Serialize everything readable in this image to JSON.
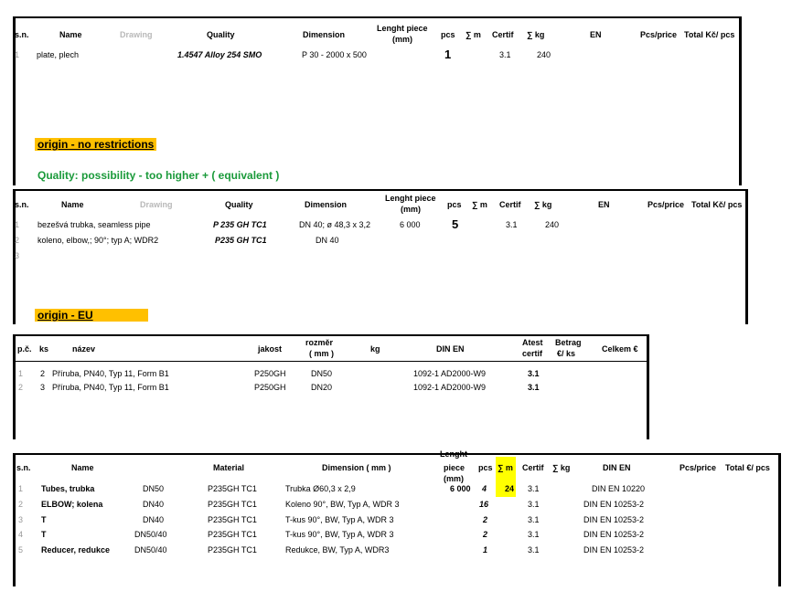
{
  "table1": {
    "headers": [
      "s.n.",
      "Name",
      "Drawing",
      "Quality",
      "Dimension",
      "Lenght piece",
      "(mm)",
      "pcs",
      "∑ m",
      "Certif",
      "∑ kg",
      "EN",
      "Pcs/price",
      "Total Kč/ pcs"
    ],
    "row": [
      "1",
      "plate, plech",
      "1.4547 Alloy 254 SMO",
      "P 30 - 2000 x 500",
      "1",
      "3.1",
      "240"
    ]
  },
  "note1": "origin - no restrictions",
  "note2": "Quality:  possibility -  too higher +   ( equivalent )",
  "table2": {
    "headers": [
      "s.n.",
      "Name",
      "Drawing",
      "Quality",
      "Dimension",
      "Lenght piece",
      "(mm)",
      "pcs",
      "∑ m",
      "Certif",
      "∑ kg",
      "EN",
      "Pcs/price",
      "Total Kč/ pcs"
    ],
    "rows": [
      [
        "1",
        "bezešvá trubka, seamless pipe",
        "P 235 GH TC1",
        "DN 40; ø 48,3 x 3,2",
        "6 000",
        "5",
        "3.1",
        "240"
      ],
      [
        "2",
        "koleno, elbow,; 90°; typ A; WDR2",
        "P235 GH TC1",
        "DN 40"
      ],
      [
        "3"
      ]
    ]
  },
  "note3": "origin - EU",
  "table3": {
    "headers": [
      "p.č.",
      "ks",
      "název",
      "jakost",
      "rozměr",
      "( mm )",
      "kg",
      "DIN EN",
      "Atest",
      "certif",
      "Betrag",
      "€/ ks",
      "Celkem €"
    ],
    "rows": [
      [
        "1",
        "2",
        "Příruba, PN40, Typ 11, Form B1",
        "P250GH",
        "DN50",
        "1092-1 AD2000-W9",
        "3.1"
      ],
      [
        "2",
        "3",
        "Příruba, PN40, Typ 11, Form B1",
        "P250GH",
        "DN20",
        "1092-1 AD2000-W9",
        "3.1"
      ]
    ]
  },
  "table4": {
    "headers": [
      "s.n.",
      "Name",
      "Material",
      "Dimension ( mm )",
      "Lenght",
      "piece",
      "(mm)",
      "pcs",
      "∑ m",
      "Certif",
      "∑ kg",
      "DIN EN",
      "Pcs/price",
      "Total €/ pcs"
    ],
    "rows": [
      [
        "1",
        "Tubes, trubka",
        "DN50",
        "P235GH TC1",
        "Trubka Ø60,3 x 2,9",
        "6 000",
        "4",
        "24",
        "3.1",
        "DIN EN 10220"
      ],
      [
        "2",
        "ELBOW; kolena",
        "DN40",
        "P235GH TC1",
        "Koleno 90°, BW, Typ A, WDR 3",
        "",
        "16",
        "",
        "3.1",
        "DIN EN 10253-2"
      ],
      [
        "3",
        "T",
        "DN40",
        "P235GH TC1",
        "T-kus 90°, BW, Typ A, WDR 3",
        "",
        "2",
        "",
        "3.1",
        "DIN EN 10253-2"
      ],
      [
        "4",
        "T",
        "DN50/40",
        "P235GH TC1",
        "T-kus 90°, BW, Typ A, WDR 3",
        "",
        "2",
        "",
        "3.1",
        "DIN EN 10253-2"
      ],
      [
        "5",
        "Reducer, redukce",
        "DN50/40",
        "P235GH TC1",
        "Redukce, BW, Typ A, WDR3",
        "",
        "1",
        "",
        "3.1",
        "DIN EN 10253-2"
      ]
    ]
  },
  "colors": {
    "origin_highlight": "#ffc000",
    "quality_green": "#1a9a3a",
    "sum_highlight": "#ffff00"
  }
}
